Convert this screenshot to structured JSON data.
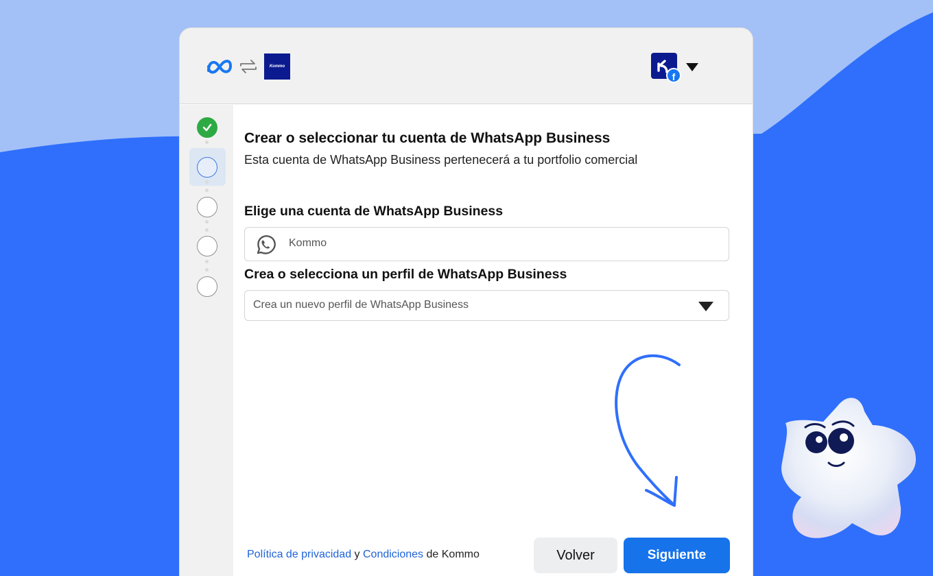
{
  "colors": {
    "background_light": "#a3c0f7",
    "background_blue": "#2f6ffb",
    "primary_button": "#1673ea",
    "link": "#1f63d8",
    "step_done": "#2eaa44",
    "kommo_brand": "#0b1b8f"
  },
  "header": {
    "meta_logo": "meta-infinity-logo",
    "swap_icon": "swap-arrows-icon",
    "partner_logo_text": "Kommo",
    "account_badge": "facebook-icon"
  },
  "stepper": {
    "steps": [
      {
        "state": "done"
      },
      {
        "state": "active"
      },
      {
        "state": "pending"
      },
      {
        "state": "pending"
      },
      {
        "state": "pending"
      }
    ]
  },
  "main": {
    "title": "Crear o seleccionar tu cuenta de WhatsApp Business",
    "subtitle": "Esta cuenta de WhatsApp Business pertenecerá a tu portfolio comercial",
    "account_label": "Elige una cuenta de WhatsApp Business",
    "account_value": "Kommo",
    "profile_label": "Crea o selecciona un perfil de WhatsApp Business",
    "profile_placeholder": "Crea un nuevo perfil de WhatsApp Business"
  },
  "footer": {
    "privacy_link": "Política de privacidad",
    "conjunction": "y",
    "terms_link": "Condiciones",
    "suffix": "de Kommo",
    "back_label": "Volver",
    "next_label": "Siguiente"
  }
}
